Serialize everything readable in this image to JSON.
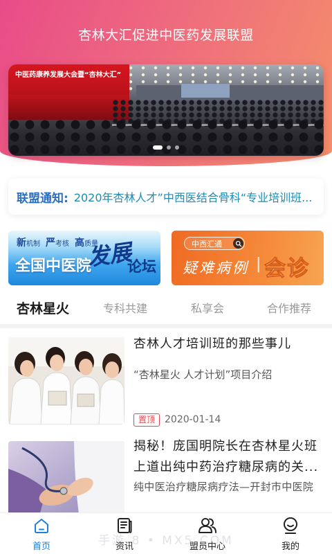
{
  "header": {
    "title": "杏林大汇促进中医药发展联盟"
  },
  "banner": {
    "photo_caption": "中医药康养发展大会暨“杏林大汇”",
    "dot_count": 3,
    "active_dot_index": 0
  },
  "notice": {
    "label": "联盟通知:",
    "text": "2020年杏林人才”中西医结合骨科“专业培训班..."
  },
  "promo_left": {
    "tagline": [
      "新机制",
      "严考核",
      "高质量"
    ],
    "headline": "全国中医院",
    "accent": "发展",
    "suffix": "论坛"
  },
  "promo_right": {
    "pill": "中西汇通",
    "pill_icon": "search-icon",
    "headline": "疑难病例",
    "divider": "|",
    "accent": "会诊"
  },
  "tabs": [
    {
      "label": "杏林星火",
      "active": true
    },
    {
      "label": "专科共建",
      "active": false
    },
    {
      "label": "私享会",
      "active": false
    },
    {
      "label": "合作推荐",
      "active": false
    }
  ],
  "articles": [
    {
      "title": "杏林人才培训班的那些事儿",
      "summary": "“杏林星火 人才计划”项目介绍",
      "tag": "置顶",
      "date": "2020-01-14"
    },
    {
      "title": "揭秘！庞国明院长在杏林星火班上道出纯中药治疗糖尿病的关...",
      "summary": "纯中医治疗糖尿病疗法—开封市中医院"
    }
  ],
  "bottom_nav": [
    {
      "label": "首页",
      "icon": "home-icon",
      "active": true
    },
    {
      "label": "资讯",
      "icon": "news-icon",
      "active": false
    },
    {
      "label": "盟员中心",
      "icon": "members-icon",
      "active": false
    },
    {
      "label": "我的",
      "icon": "profile-icon",
      "active": false
    }
  ],
  "watermark": "手游  8 • MX5.COM",
  "colors": {
    "header_pink": "#e84c88",
    "header_orange": "#f48f6a",
    "primary_blue": "#1f80dc",
    "notice_label": "#2c6fbf",
    "notice_text": "#1a8cb8",
    "tag_red": "#e8464b",
    "inactive_tab": "#999999"
  }
}
